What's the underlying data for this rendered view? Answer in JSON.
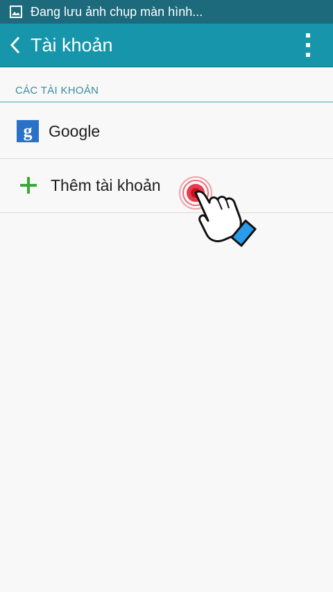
{
  "status_bar": {
    "notification_icon": "image-icon",
    "text": "Đang lưu ảnh chụp màn hình..."
  },
  "action_bar": {
    "back_icon": "chevron-left-icon",
    "title": "Tài khoản",
    "menu_icon": "more-vert-icon"
  },
  "section": {
    "header": "CÁC TÀI KHOẢN"
  },
  "accounts": [
    {
      "icon": "google-icon",
      "icon_glyph": "g",
      "label": "Google"
    }
  ],
  "add_account": {
    "icon": "plus-icon",
    "label": "Thêm tài khoản"
  },
  "overlay": {
    "icon": "tap-hand-icon"
  },
  "colors": {
    "status_bar": "#1c6a7c",
    "action_bar": "#1795ab",
    "section_header": "#3b8b9c",
    "plus": "#3aa73a",
    "google_bg": "#2a72c6"
  }
}
